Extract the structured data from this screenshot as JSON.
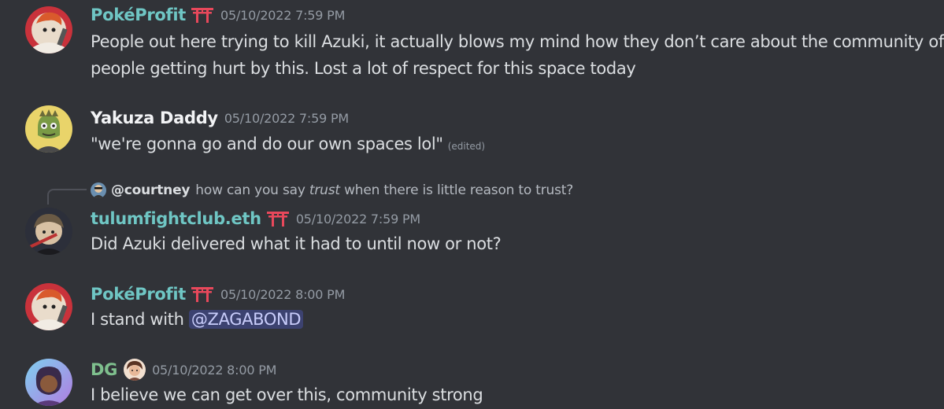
{
  "colors": {
    "background": "#313338",
    "username_teal": "#6fc6c4",
    "username_white": "#f2f3f5",
    "username_green": "#7fc08e",
    "timestamp": "#949ba4",
    "text": "#dbdee1",
    "mention_bg": "#3c4270",
    "mention_text": "#c9cdfb",
    "badge_red": "#e8485b"
  },
  "messages": [
    {
      "username": "PokéProfit",
      "badge": "torii-gate-icon",
      "timestamp": "05/10/2022 7:59 PM",
      "line1": "People out here trying to kill Azuki, it actually blows my mind how they don’t care about the community of",
      "line2": "people getting hurt by this. Lost a lot of respect for this space today"
    },
    {
      "username": "Yakuza Daddy",
      "timestamp": "05/10/2022 7:59 PM",
      "text": "\"we're gonna go and do our own spaces lol\"",
      "edited": "(edited)"
    },
    {
      "reply": {
        "user": "@courtney",
        "pre": "how can you say ",
        "emph": "trust",
        "post": " when there is little reason to trust?"
      },
      "username": "tulumfightclub.eth",
      "badge": "torii-gate-icon",
      "timestamp": "05/10/2022 7:59 PM",
      "text": "Did Azuki delivered what it had to until now or not?"
    },
    {
      "username": "PokéProfit",
      "badge": "torii-gate-icon",
      "timestamp": "05/10/2022 8:00 PM",
      "text_pre": "I stand with ",
      "mention": "@ZAGABOND"
    },
    {
      "username": "DG",
      "badge": "avatar-emoji-icon",
      "timestamp": "05/10/2022 8:00 PM",
      "text": "I believe we can get over this, community strong"
    }
  ]
}
